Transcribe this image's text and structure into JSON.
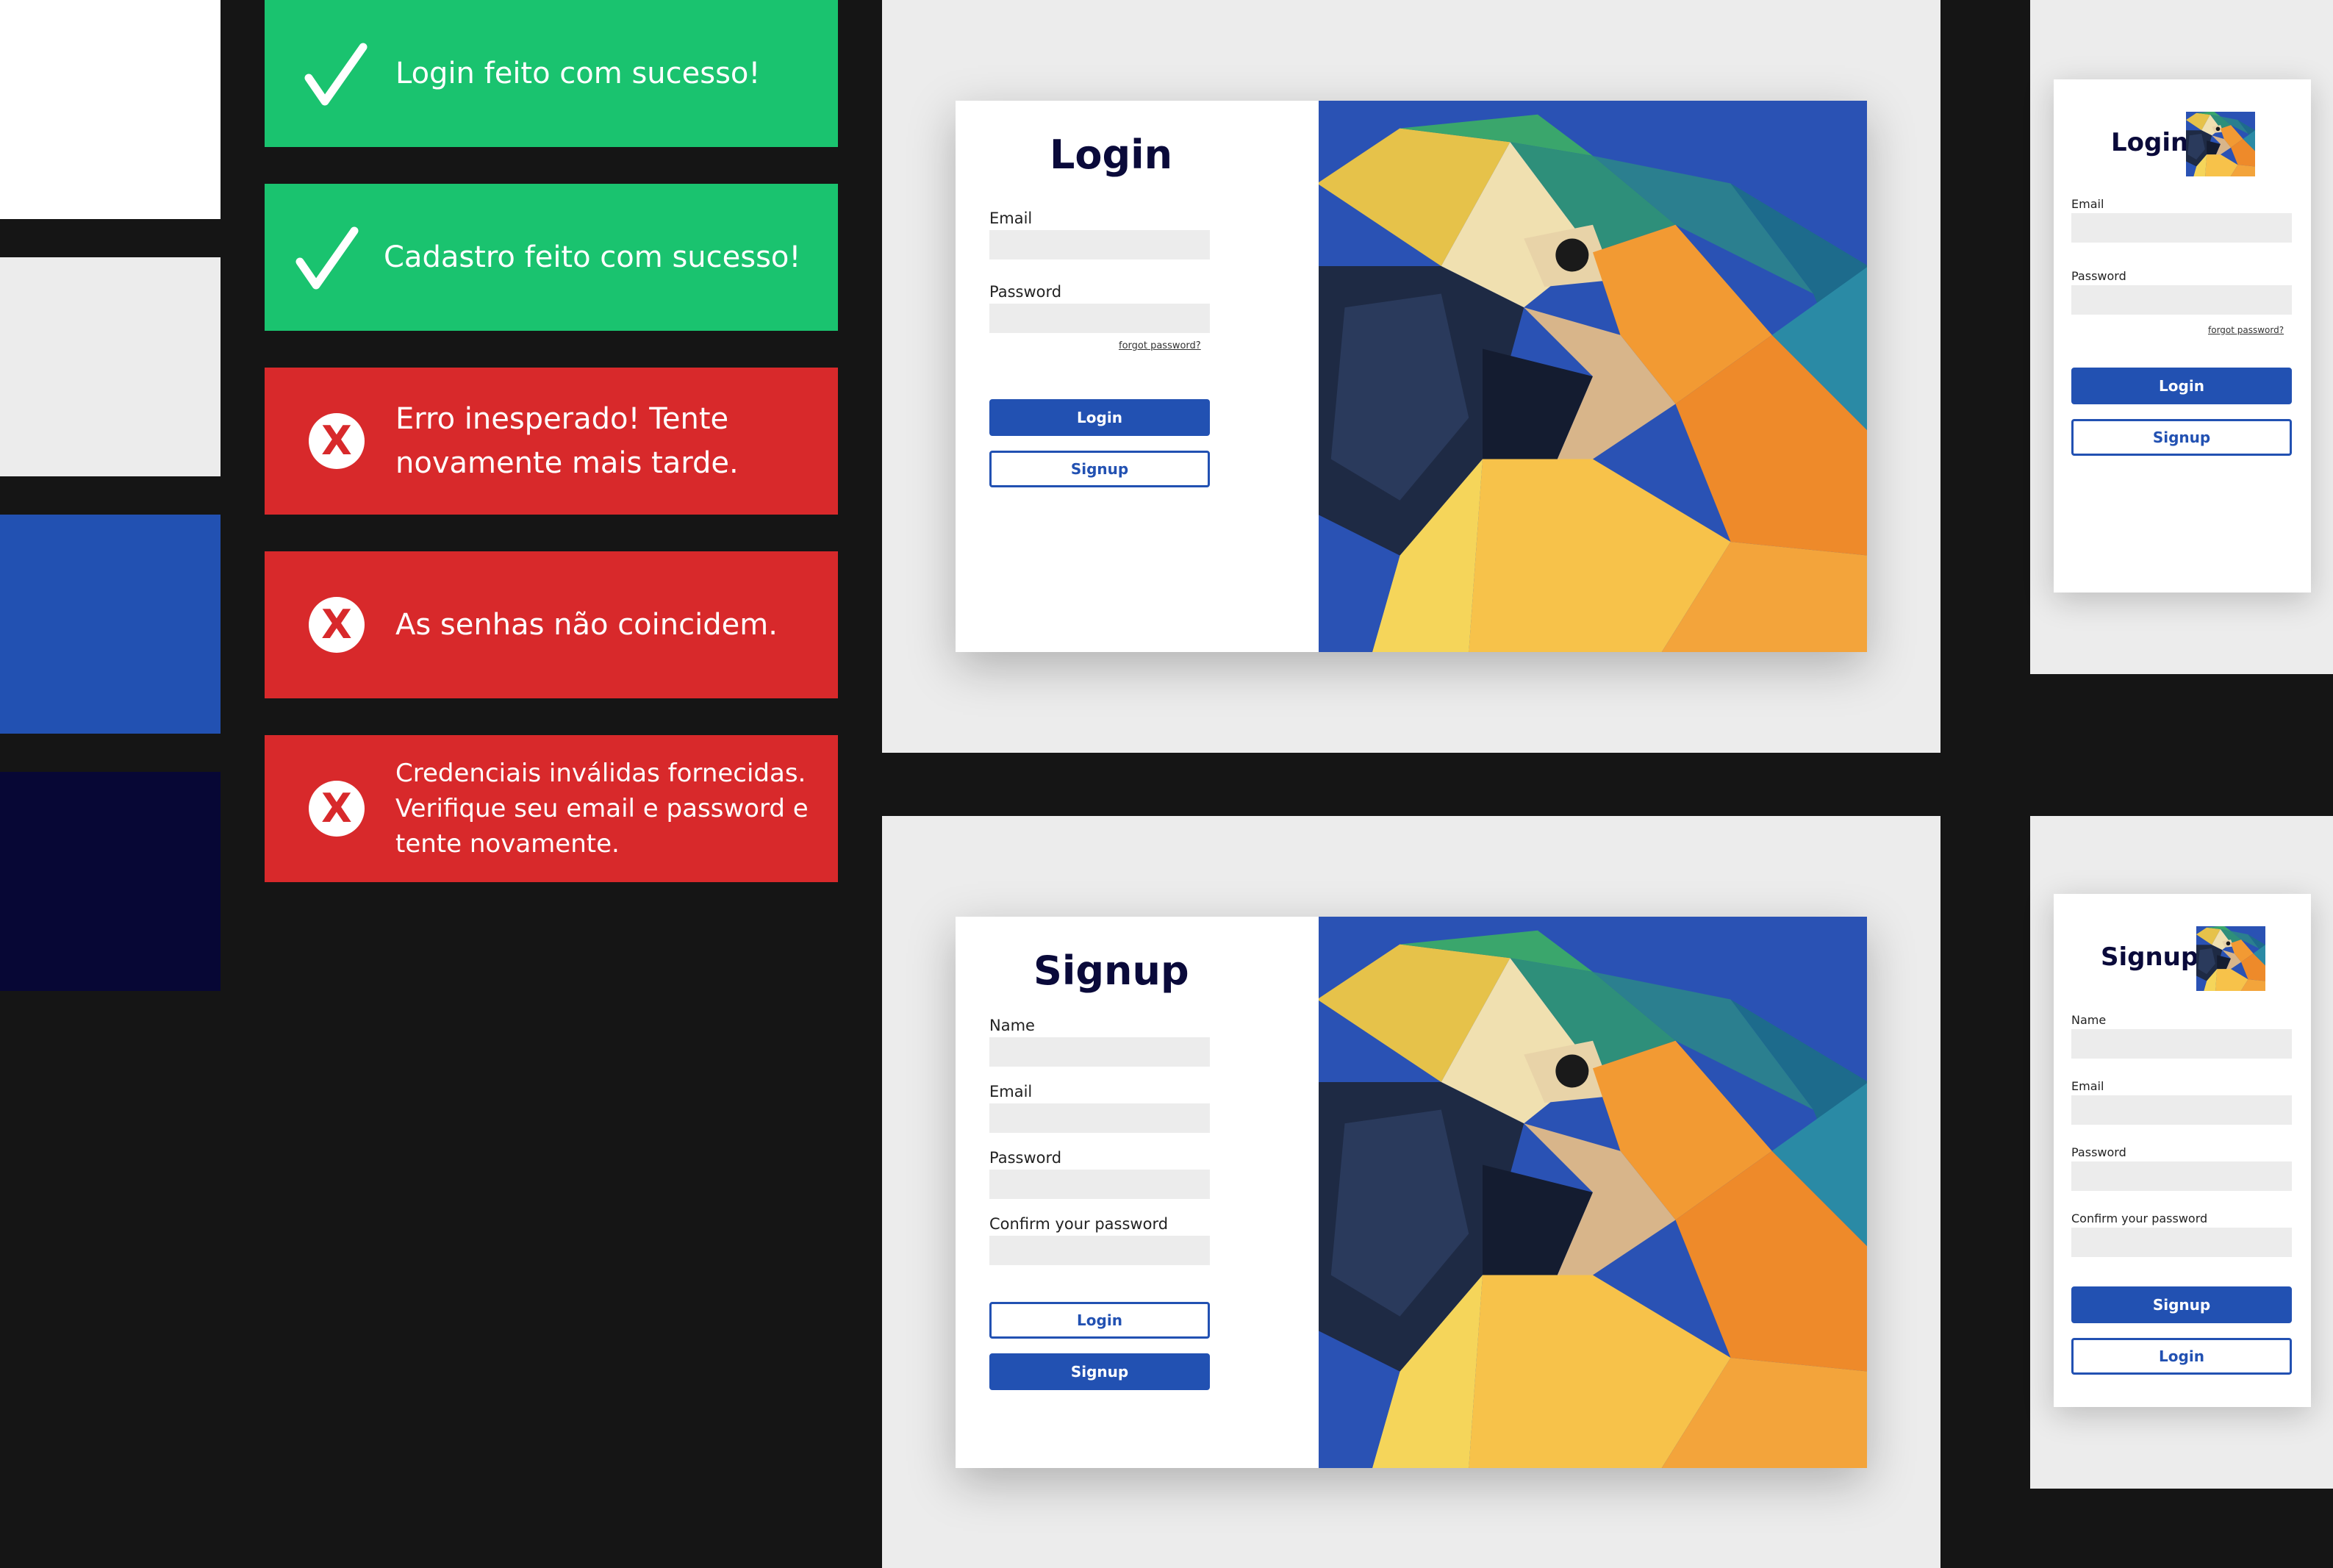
{
  "palette": [
    {
      "name": "white",
      "color": "#ffffff"
    },
    {
      "name": "light-gray",
      "color": "#ececec"
    },
    {
      "name": "blue",
      "color": "#2251b2"
    },
    {
      "name": "navy",
      "color": "#070735"
    }
  ],
  "toasts": [
    {
      "type": "success",
      "icon": "check-icon",
      "message": "Login feito com sucesso!"
    },
    {
      "type": "success",
      "icon": "check-icon",
      "message": "Cadastro feito com sucesso!"
    },
    {
      "type": "error",
      "icon": "error-circle-icon",
      "message": "Erro inesperado! Tente novamente mais tarde."
    },
    {
      "type": "error",
      "icon": "error-circle-icon",
      "message": "As senhas não coincidem."
    },
    {
      "type": "error",
      "icon": "error-circle-icon",
      "message": "Credenciais inválidas fornecidas. Verifique seu email e password e tente novamente."
    }
  ],
  "login_desktop": {
    "title": "Login",
    "email_label": "Email",
    "password_label": "Password",
    "forgot_link": "forgot password?",
    "login_button": "Login",
    "signup_button": "Signup"
  },
  "signup_desktop": {
    "title": "Signup",
    "name_label": "Name",
    "email_label": "Email",
    "password_label": "Password",
    "confirm_label": "Confirm your password",
    "login_button": "Login",
    "signup_button": "Signup"
  },
  "login_mobile": {
    "title": "Login",
    "email_label": "Email",
    "password_label": "Password",
    "forgot_link": "forgot password?",
    "login_button": "Login",
    "signup_button": "Signup"
  },
  "signup_mobile": {
    "title": "Signup",
    "name_label": "Name",
    "email_label": "Email",
    "password_label": "Password",
    "confirm_label": "Confirm your password",
    "signup_button": "Signup",
    "login_button": "Login"
  },
  "colors": {
    "success": "#1ac36f",
    "error": "#d8292b",
    "brand_blue": "#2251b2",
    "background": "#151515",
    "panel": "#ececec"
  },
  "illustration": "low-poly-parrot-illustration"
}
